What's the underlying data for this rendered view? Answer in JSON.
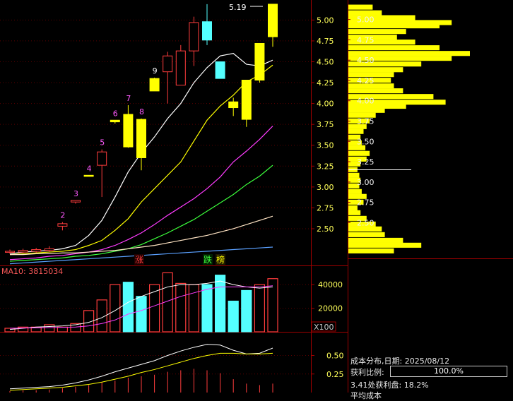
{
  "colors": {
    "up": "#ff3d3d",
    "down": "#54ffff",
    "limit_up": "#ffff00",
    "panel_border": "#a00000",
    "axis_text": "#ffff5a",
    "chip": "#ffff00",
    "ma5": "#ffffff",
    "ma10": "#ffff00",
    "ma20": "#ff3cff",
    "ma30": "#3cff3c",
    "ma60": "#ffe4c4",
    "ma120": "#5aa0ff",
    "tag_zhang": "#ff3d3d",
    "tag_die": "#3cff3c",
    "tag_bang": "#ffff00",
    "kdj_k": "#ffffff",
    "kdj_d": "#ffff00"
  },
  "price_panel": {
    "y_ticks": [
      "5.00",
      "4.75",
      "4.50",
      "4.25",
      "4.00",
      "3.75",
      "3.50",
      "3.25",
      "3.00",
      "2.75",
      "2.50"
    ],
    "ylim": [
      2.06,
      5.24
    ],
    "high_label": "5.19",
    "tags": {
      "zhang": "涨",
      "die": "跌",
      "bang": "榜"
    },
    "sequence_labels": [
      {
        "idx": 4,
        "text": "2"
      },
      {
        "idx": 5,
        "text": "3"
      },
      {
        "idx": 6,
        "text": "4"
      },
      {
        "idx": 7,
        "text": "5"
      },
      {
        "idx": 8,
        "text": "6"
      },
      {
        "idx": 9,
        "text": "7"
      },
      {
        "idx": 10,
        "text": "8"
      },
      {
        "idx": 11,
        "text": "9"
      }
    ]
  },
  "chart_data": [
    {
      "type": "candlestick",
      "candles": [
        {
          "open": 2.22,
          "close": 2.23,
          "high": 2.25,
          "low": 2.2
        },
        {
          "open": 2.22,
          "close": 2.24,
          "high": 2.26,
          "low": 2.21
        },
        {
          "open": 2.23,
          "close": 2.25,
          "high": 2.27,
          "low": 2.21
        },
        {
          "open": 2.24,
          "close": 2.26,
          "high": 2.29,
          "low": 2.22
        },
        {
          "open": 2.53,
          "close": 2.56,
          "high": 2.58,
          "low": 2.48
        },
        {
          "open": 2.82,
          "close": 2.84,
          "high": 2.84,
          "low": 2.8
        },
        {
          "open": 3.14,
          "close": 3.14,
          "high": 3.14,
          "low": 3.13
        },
        {
          "open": 3.26,
          "close": 3.42,
          "high": 3.45,
          "low": 2.88
        },
        {
          "open": 3.78,
          "close": 3.8,
          "high": 3.8,
          "low": 3.76
        },
        {
          "open": 3.87,
          "close": 3.48,
          "high": 3.98,
          "low": 3.47
        },
        {
          "open": 3.81,
          "close": 3.35,
          "high": 3.82,
          "low": 3.2
        },
        {
          "open": 4.15,
          "close": 4.3,
          "high": 4.31,
          "low": 4.15
        },
        {
          "open": 4.38,
          "close": 4.57,
          "high": 4.62,
          "low": 4.0
        },
        {
          "open": 4.22,
          "close": 4.63,
          "high": 4.7,
          "low": 4.22
        },
        {
          "open": 4.63,
          "close": 4.97,
          "high": 5.04,
          "low": 4.45
        },
        {
          "open": 4.98,
          "close": 4.76,
          "high": 5.19,
          "low": 4.7
        },
        {
          "open": 4.5,
          "close": 4.3,
          "high": 4.5,
          "low": 4.3
        },
        {
          "open": 4.02,
          "close": 3.95,
          "high": 4.07,
          "low": 3.85
        },
        {
          "open": 4.28,
          "close": 3.81,
          "high": 4.28,
          "low": 3.72
        },
        {
          "open": 4.28,
          "close": 4.72,
          "high": 4.72,
          "low": 4.25
        },
        {
          "open": 4.8,
          "close": 5.19,
          "high": 5.19,
          "low": 4.68
        }
      ],
      "ma_lines": {
        "ma5": [
          2.2,
          2.22,
          2.23,
          2.24,
          2.26,
          2.3,
          2.42,
          2.6,
          2.88,
          3.18,
          3.41,
          3.6,
          3.82,
          4.0,
          4.25,
          4.43,
          4.57,
          4.6,
          4.47,
          4.45,
          4.52
        ],
        "ma10": [
          2.19,
          2.2,
          2.21,
          2.22,
          2.23,
          2.25,
          2.3,
          2.36,
          2.48,
          2.62,
          2.82,
          2.98,
          3.14,
          3.3,
          3.55,
          3.8,
          3.97,
          4.1,
          4.26,
          4.34,
          4.46
        ],
        "ma20": [
          2.13,
          2.14,
          2.15,
          2.17,
          2.18,
          2.2,
          2.22,
          2.25,
          2.3,
          2.37,
          2.45,
          2.55,
          2.66,
          2.76,
          2.86,
          2.98,
          3.12,
          3.3,
          3.43,
          3.57,
          3.73
        ],
        "ma30": [
          2.11,
          2.12,
          2.13,
          2.14,
          2.15,
          2.17,
          2.18,
          2.2,
          2.23,
          2.26,
          2.31,
          2.38,
          2.45,
          2.53,
          2.61,
          2.71,
          2.81,
          2.91,
          3.03,
          3.13,
          3.26
        ],
        "ma60": [
          2.19,
          2.19,
          2.2,
          2.2,
          2.21,
          2.21,
          2.22,
          2.23,
          2.24,
          2.26,
          2.28,
          2.3,
          2.33,
          2.36,
          2.39,
          2.42,
          2.46,
          2.5,
          2.55,
          2.6,
          2.65
        ],
        "ma120": [
          2.08,
          2.09,
          2.1,
          2.11,
          2.12,
          2.13,
          2.14,
          2.15,
          2.16,
          2.17,
          2.18,
          2.19,
          2.2,
          2.21,
          2.22,
          2.23,
          2.24,
          2.25,
          2.26,
          2.27,
          2.28
        ]
      }
    },
    {
      "type": "bar",
      "title": "MA10: 3815034",
      "y_ticks": [
        "40000",
        "20000"
      ],
      "unit_label": "X100",
      "ylim": [
        0,
        55000
      ],
      "values": [
        3000,
        4000,
        4000,
        6000,
        4000,
        7000,
        18000,
        27000,
        40000,
        42000,
        30000,
        40000,
        50000,
        41000,
        40000,
        40000,
        48000,
        26000,
        35000,
        40000,
        45000
      ],
      "ma_lines": {
        "ma5": [
          2000,
          3000,
          4000,
          4500,
          5000,
          6000,
          8000,
          12000,
          18000,
          25000,
          30000,
          34000,
          38000,
          40000,
          40000,
          41000,
          43000,
          40000,
          38000,
          37000,
          38000
        ],
        "ma10": [
          3000,
          3200,
          3400,
          3600,
          3800,
          4000,
          5000,
          7000,
          10000,
          15000,
          18000,
          22000,
          26000,
          30000,
          33000,
          36000,
          38000,
          38000,
          38000,
          38000,
          39000
        ]
      }
    },
    {
      "type": "line",
      "y_ticks": [
        "0.50",
        "0.25"
      ],
      "ylim": [
        0,
        0.8
      ],
      "series": [
        {
          "values": [
            0.05,
            0.06,
            0.07,
            0.08,
            0.1,
            0.13,
            0.17,
            0.22,
            0.28,
            0.33,
            0.38,
            0.43,
            0.5,
            0.56,
            0.61,
            0.65,
            0.64,
            0.57,
            0.52,
            0.53,
            0.6
          ]
        },
        {
          "values": [
            0.03,
            0.04,
            0.05,
            0.06,
            0.07,
            0.09,
            0.11,
            0.14,
            0.18,
            0.22,
            0.27,
            0.31,
            0.36,
            0.41,
            0.46,
            0.5,
            0.53,
            0.53,
            0.52,
            0.52,
            0.53
          ]
        }
      ],
      "stems": [
        0.02,
        0.03,
        0.03,
        0.04,
        0.06,
        0.08,
        0.1,
        0.14,
        0.16,
        0.2,
        0.22,
        0.24,
        0.28,
        0.3,
        0.32,
        0.3,
        0.26,
        0.18,
        0.12,
        0.1,
        0.12
      ]
    },
    {
      "type": "horizontal_bar",
      "y": [
        5.15,
        5.08,
        5.02,
        4.96,
        4.92,
        4.85,
        4.78,
        4.72,
        4.65,
        4.58,
        4.52,
        4.45,
        4.38,
        4.32,
        4.25,
        4.18,
        4.12,
        4.05,
        3.98,
        3.93,
        3.88,
        3.82,
        3.75,
        3.68,
        3.62,
        3.55,
        3.48,
        3.42,
        3.35,
        3.28,
        3.22,
        3.15,
        3.08,
        3.02,
        2.95,
        2.88,
        2.82,
        2.75,
        2.68,
        2.62,
        2.55,
        2.48,
        2.42,
        2.35,
        2.28,
        2.22,
        2.15
      ],
      "values": [
        40,
        55,
        110,
        170,
        150,
        95,
        80,
        110,
        150,
        200,
        170,
        120,
        90,
        75,
        70,
        75,
        90,
        140,
        160,
        95,
        60,
        45,
        35,
        30,
        25,
        20,
        22,
        28,
        35,
        30,
        20,
        15,
        18,
        20,
        18,
        22,
        30,
        25,
        15,
        20,
        30,
        45,
        55,
        60,
        90,
        120,
        75
      ]
    }
  ],
  "chip_panel": {
    "y_ticks": [
      "5.00",
      "4.75",
      "4.50",
      "4.25",
      "4.00",
      "3.75",
      "3.50",
      "3.25",
      "3.00",
      "2.75",
      "2.50"
    ],
    "date_line": "成本分布,日期: 2025/08/12",
    "ratio_label": "获利比例:",
    "ratio_value": "100.0%",
    "ratio_fraction": 1.0,
    "profit_line": "3.41处获利盘: 18.2%",
    "avg_cost_label": "平均成本"
  }
}
